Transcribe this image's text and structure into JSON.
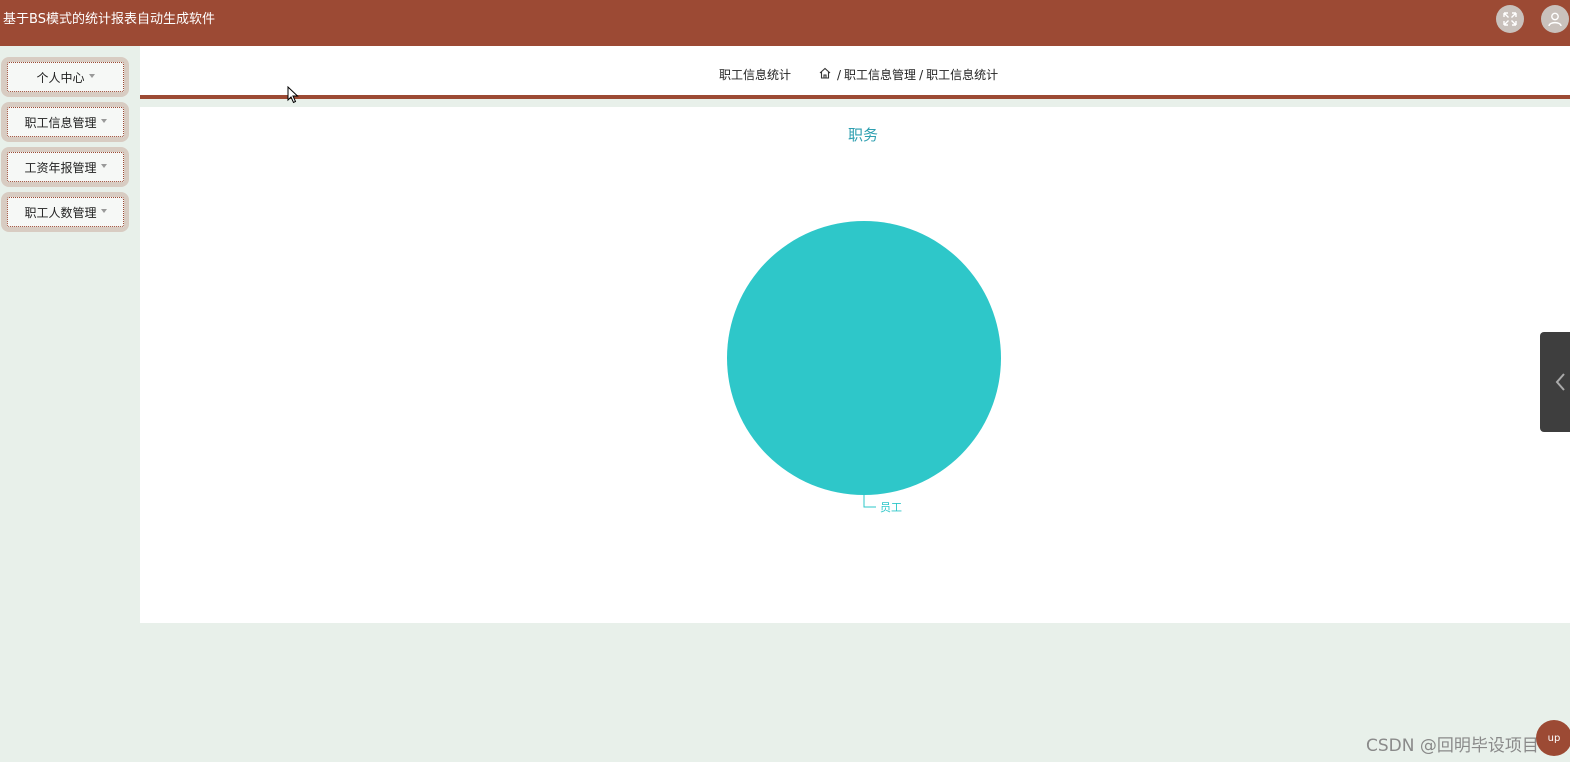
{
  "app": {
    "title": "基于BS模式的统计报表自动生成软件"
  },
  "sidebar": {
    "items": [
      {
        "label": "个人中心"
      },
      {
        "label": "职工信息管理"
      },
      {
        "label": "工资年报管理"
      },
      {
        "label": "职工人数管理"
      }
    ]
  },
  "header": {
    "page_label": "职工信息统计",
    "breadcrumb": [
      "职工信息管理",
      "职工信息统计"
    ],
    "separator": "/"
  },
  "chart_data": {
    "type": "pie",
    "title": "职务",
    "slices": [
      {
        "label": "员工",
        "value": 1,
        "color": "#2ec7c9"
      }
    ]
  },
  "colors": {
    "brand": "#9c4a34",
    "background": "#e8f0ea",
    "pie": "#2ec7c9",
    "title": "#2e9fb0"
  },
  "icons": {
    "fullscreen": "fullscreen-icon",
    "user": "user-icon",
    "home": "home-icon",
    "collapse": "chevron-left-icon"
  },
  "watermark": "CSDN @回明毕设项目",
  "float_button": {
    "label": "up"
  }
}
